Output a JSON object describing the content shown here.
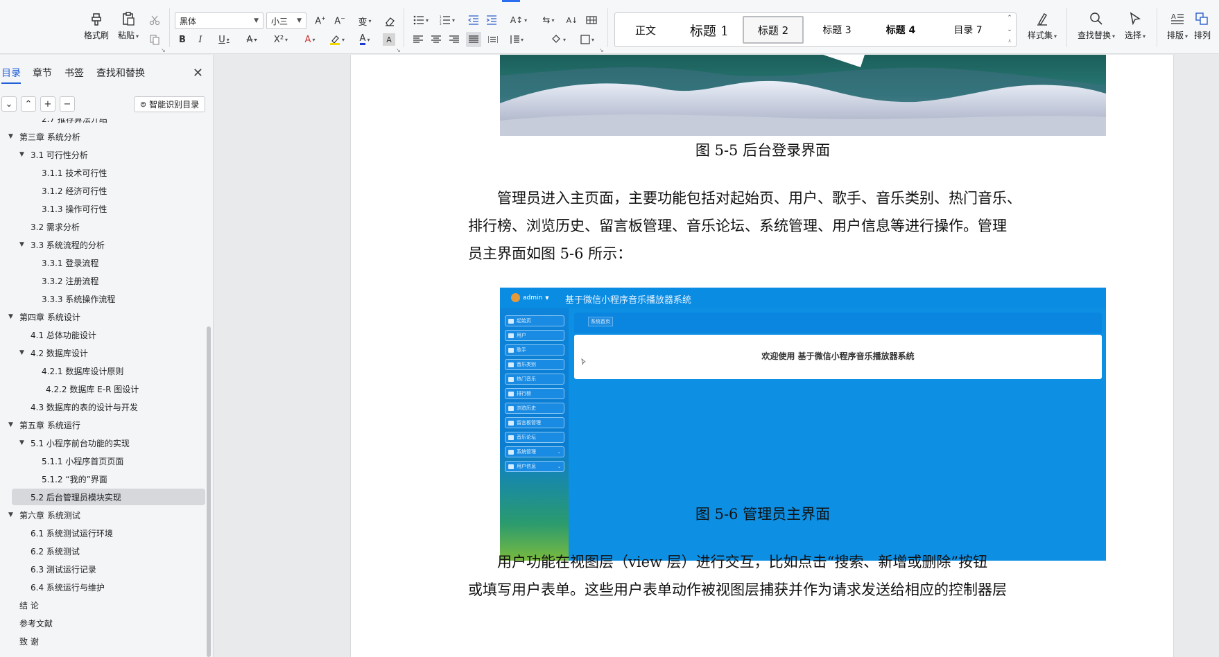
{
  "ribbon": {
    "format_painter": "格式刷",
    "paste": "粘贴",
    "font_name": "黑体",
    "font_size": "小三",
    "styles": [
      "正文",
      "标题 1",
      "标题 2",
      "标题 3",
      "标题 4",
      "目录 7"
    ],
    "styles_set": "样式集",
    "find_replace": "查找替换",
    "select": "选择",
    "layout": "排版",
    "arrange": "排列"
  },
  "sidebar": {
    "tabs": [
      "目录",
      "章节",
      "书签",
      "查找和替换"
    ],
    "smart_toc": "智能识别目录",
    "toc": [
      {
        "text": "2.7 推荐算法介绍",
        "level": 3,
        "arrow": false
      },
      {
        "text": "第三章  系统分析",
        "level": 1,
        "arrow": true
      },
      {
        "text": "3.1 可行性分析",
        "level": 2,
        "arrow": true
      },
      {
        "text": "3.1.1 技术可行性",
        "level": 3,
        "arrow": false
      },
      {
        "text": "3.1.2 经济可行性",
        "level": 3,
        "arrow": false
      },
      {
        "text": "3.1.3 操作可行性",
        "level": 3,
        "arrow": false
      },
      {
        "text": "3.2 需求分析",
        "level": 2,
        "arrow": false
      },
      {
        "text": "3.3 系统流程的分析",
        "level": 2,
        "arrow": true
      },
      {
        "text": "3.3.1  登录流程",
        "level": 3,
        "arrow": false
      },
      {
        "text": "3.3.2  注册流程",
        "level": 3,
        "arrow": false
      },
      {
        "text": "3.3.3 系统操作流程",
        "level": 3,
        "arrow": false
      },
      {
        "text": "第四章  系统设计",
        "level": 1,
        "arrow": true
      },
      {
        "text": "4.1 总体功能设计",
        "level": 2,
        "arrow": false
      },
      {
        "text": "4.2  数据库设计",
        "level": 2,
        "arrow": true
      },
      {
        "text": "4.2.1 数据库设计原则",
        "level": 3,
        "arrow": false
      },
      {
        "text": "4.2.2 数据库 E-R 图设计",
        "level": 3,
        "arrow": false
      },
      {
        "text": "4.3 数据库的表的设计与开发",
        "level": 2,
        "arrow": false
      },
      {
        "text": "第五章  系统运行",
        "level": 1,
        "arrow": true
      },
      {
        "text": "5.1 小程序前台功能的实现",
        "level": 2,
        "arrow": true
      },
      {
        "text": "5.1.1  小程序首页页面",
        "level": 3,
        "arrow": false
      },
      {
        "text": "5.1.2  “我的”界面",
        "level": 3,
        "arrow": false
      },
      {
        "text": "5.2 后台管理员模块实现",
        "level": 2,
        "arrow": false,
        "selected": true
      },
      {
        "text": "第六章  系统测试",
        "level": 1,
        "arrow": true
      },
      {
        "text": "6.1  系统测试运行环境",
        "level": 2,
        "arrow": false
      },
      {
        "text": "6.2  系统测试",
        "level": 2,
        "arrow": false
      },
      {
        "text": "6.3  测试运行记录",
        "level": 2,
        "arrow": false
      },
      {
        "text": "6.4 系统运行与维护",
        "level": 2,
        "arrow": false
      },
      {
        "text": "结  论",
        "level": 1,
        "arrow": false
      },
      {
        "text": "参考文献",
        "level": 1,
        "arrow": false
      },
      {
        "text": "致  谢",
        "level": 1,
        "arrow": false
      }
    ]
  },
  "document": {
    "caption1": "图 5-5 后台登录界面",
    "para1": [
      "管理员进入主页面，主要功能包括对起始页、用户、歌手、音乐类别、热门音乐、",
      "排行榜、浏览历史、留言板管理、音乐论坛、系统管理、用户信息等进行操作。管理",
      "员主界面如图 5-6 所示："
    ],
    "caption2": "图 5-6 管理员主界面",
    "para2": [
      "用户功能在视图层（view 层）进行交互，比如点击“搜索、新增或删除”按钮",
      "或填写用户表单。这些用户表单动作被视图层捕获并作为请求发送给相应的控制器层"
    ]
  },
  "admin_screenshot": {
    "user": "admin",
    "title": "基于微信小程序音乐播放器系统",
    "breadcrumb": "系统首页",
    "welcome": "欢迎使用 基于微信小程序音乐播放器系统",
    "menu": [
      "起始页",
      "用户",
      "歌手",
      "音乐类别",
      "热门音乐",
      "排行榜",
      "浏览历史",
      "留言板管理",
      "音乐论坛",
      "系统管理",
      "用户信息"
    ]
  }
}
